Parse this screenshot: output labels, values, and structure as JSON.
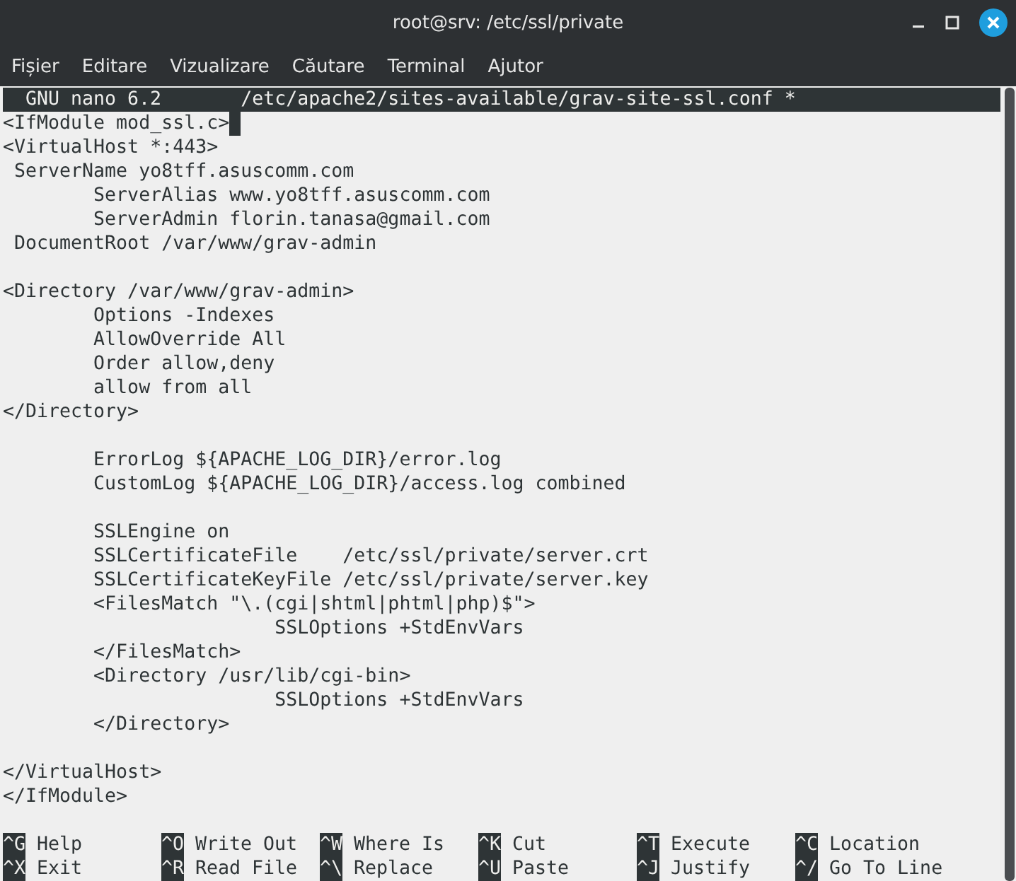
{
  "window": {
    "title": "root@srv: /etc/ssl/private"
  },
  "menu": [
    {
      "label": "Fișier"
    },
    {
      "label": "Editare"
    },
    {
      "label": "Vizualizare"
    },
    {
      "label": "Căutare"
    },
    {
      "label": "Terminal"
    },
    {
      "label": "Ajutor"
    }
  ],
  "editor": {
    "version": "GNU nano 6.2",
    "filename": "/etc/apache2/sites-available/grav-site-ssl.conf",
    "modified_mark": "*",
    "lines": [
      {
        "kind": "text",
        "text": "<IfModule mod_ssl.c>",
        "cursor": true
      },
      {
        "kind": "text",
        "text": "<VirtualHost *:443>",
        "cursor": false
      },
      {
        "kind": "text",
        "text": " ServerName yo8tff.asuscomm.com",
        "cursor": false
      },
      {
        "kind": "text",
        "text": "        ServerAlias www.yo8tff.asuscomm.com",
        "cursor": false
      },
      {
        "kind": "text",
        "text": "        ServerAdmin florin.tanasa@gmail.com",
        "cursor": false
      },
      {
        "kind": "text",
        "text": " DocumentRoot /var/www/grav-admin",
        "cursor": false
      },
      {
        "kind": "blank"
      },
      {
        "kind": "text",
        "text": "<Directory /var/www/grav-admin>",
        "cursor": false
      },
      {
        "kind": "text",
        "text": "        Options -Indexes",
        "cursor": false
      },
      {
        "kind": "text",
        "text": "        AllowOverride All",
        "cursor": false
      },
      {
        "kind": "text",
        "text": "        Order allow,deny",
        "cursor": false
      },
      {
        "kind": "text",
        "text": "        allow from all",
        "cursor": false
      },
      {
        "kind": "text",
        "text": "</Directory>",
        "cursor": false
      },
      {
        "kind": "blank"
      },
      {
        "kind": "text",
        "text": "        ErrorLog ${APACHE_LOG_DIR}/error.log",
        "cursor": false
      },
      {
        "kind": "text",
        "text": "        CustomLog ${APACHE_LOG_DIR}/access.log combined",
        "cursor": false
      },
      {
        "kind": "blank"
      },
      {
        "kind": "text",
        "text": "        SSLEngine on",
        "cursor": false
      },
      {
        "kind": "text",
        "text": "        SSLCertificateFile    /etc/ssl/private/server.crt",
        "cursor": false
      },
      {
        "kind": "text",
        "text": "        SSLCertificateKeyFile /etc/ssl/private/server.key",
        "cursor": false
      },
      {
        "kind": "text",
        "text": "        <FilesMatch \"\\.(cgi|shtml|phtml|php)$\">",
        "cursor": false
      },
      {
        "kind": "text",
        "text": "                        SSLOptions +StdEnvVars",
        "cursor": false
      },
      {
        "kind": "text",
        "text": "        </FilesMatch>",
        "cursor": false
      },
      {
        "kind": "text",
        "text": "        <Directory /usr/lib/cgi-bin>",
        "cursor": false
      },
      {
        "kind": "text",
        "text": "                        SSLOptions +StdEnvVars",
        "cursor": false
      },
      {
        "kind": "text",
        "text": "        </Directory>",
        "cursor": false
      },
      {
        "kind": "blank"
      },
      {
        "kind": "text",
        "text": "</VirtualHost>",
        "cursor": false
      },
      {
        "kind": "text",
        "text": "</IfModule>",
        "cursor": false
      }
    ],
    "shortcuts": [
      [
        {
          "key": "^G",
          "label": "Help"
        },
        {
          "key": "^O",
          "label": "Write Out"
        },
        {
          "key": "^W",
          "label": "Where Is"
        },
        {
          "key": "^K",
          "label": "Cut"
        },
        {
          "key": "^T",
          "label": "Execute"
        },
        {
          "key": "^C",
          "label": "Location"
        }
      ],
      [
        {
          "key": "^X",
          "label": "Exit"
        },
        {
          "key": "^R",
          "label": "Read File"
        },
        {
          "key": "^\\",
          "label": "Replace"
        },
        {
          "key": "^U",
          "label": "Paste"
        },
        {
          "key": "^J",
          "label": "Justify"
        },
        {
          "key": "^/",
          "label": "Go To Line"
        }
      ]
    ]
  }
}
